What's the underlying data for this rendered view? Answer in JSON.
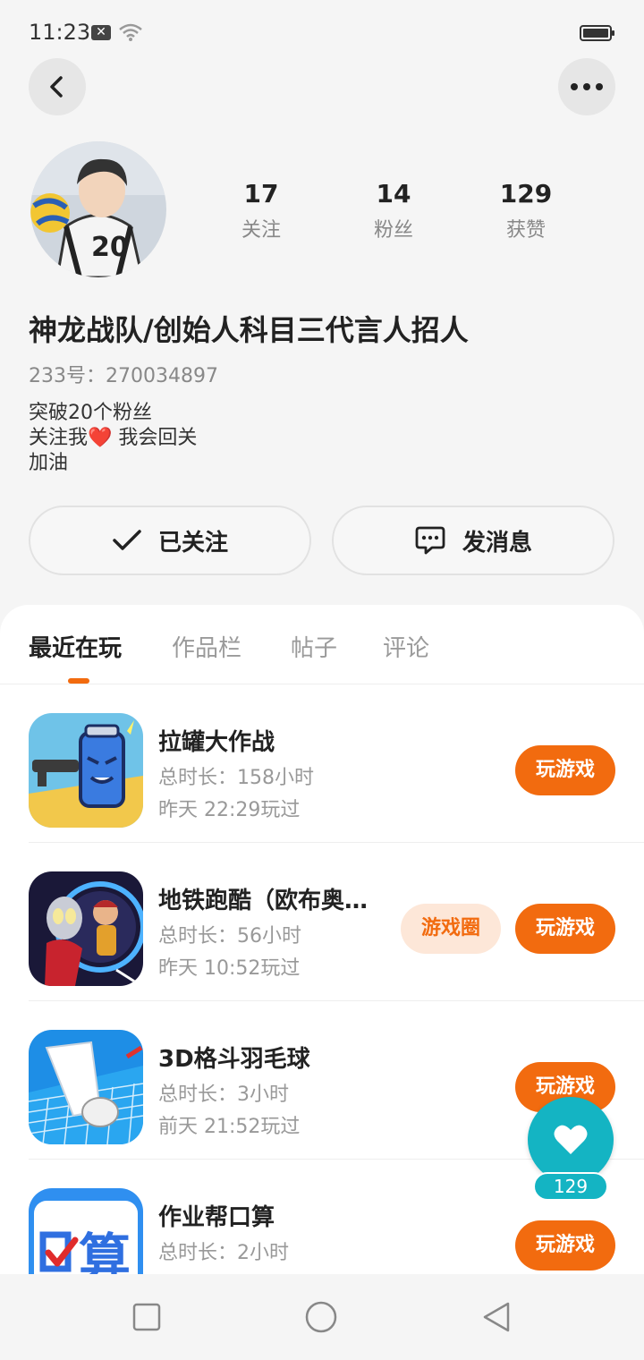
{
  "status_bar": {
    "time": "11:23",
    "notification_icon": "close-box-icon",
    "wifi_icon": "wifi-icon",
    "battery_icon": "battery-icon"
  },
  "header": {
    "back_icon": "chevron-left-icon",
    "more_icon": "more-dots-icon"
  },
  "profile": {
    "stats": [
      {
        "value": "17",
        "label": "关注"
      },
      {
        "value": "14",
        "label": "粉丝"
      },
      {
        "value": "129",
        "label": "获赞"
      }
    ],
    "name": "神龙战队/创始人科目三代言人招人",
    "id_text": "233号：270034897",
    "bio": {
      "line1": "突破20个粉丝",
      "line2_pre": "关注我",
      "line2_heart": "❤️",
      "line2_post": " 我会回关",
      "line3": "加油"
    }
  },
  "actions": {
    "follow_label": "已关注",
    "message_label": "发消息"
  },
  "tabs": [
    "最近在玩",
    "作品栏",
    "帖子",
    "评论"
  ],
  "games": [
    {
      "name": "拉罐大作战",
      "total": "总时长：158小时",
      "last": "昨天 22:29玩过",
      "play": "玩游戏"
    },
    {
      "name": "地铁跑酷（欧布奥…",
      "total": "总时长：56小时",
      "last": "昨天 10:52玩过",
      "play": "玩游戏",
      "circle": "游戏圈"
    },
    {
      "name": "3D格斗羽毛球",
      "total": "总时长：3小时",
      "last": "前天 21:52玩过",
      "play": "玩游戏"
    },
    {
      "name": "作业帮口算",
      "total": "总时长：2小时",
      "last": "",
      "play": "玩游戏"
    }
  ],
  "like_fab": {
    "count": "129",
    "icon": "heart-icon"
  },
  "colors": {
    "accent": "#f26b0f",
    "accent_light": "#fde7d8",
    "teal": "#14b4c3"
  }
}
